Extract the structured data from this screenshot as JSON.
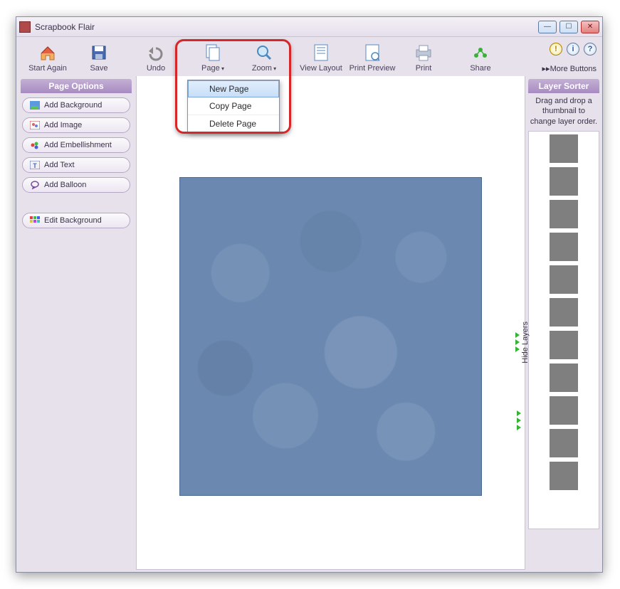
{
  "window": {
    "title": "Scrapbook Flair"
  },
  "toolbar": {
    "start_again": "Start Again",
    "save": "Save",
    "undo": "Undo",
    "page": "Page",
    "zoom": "Zoom",
    "view_layout": "View Layout",
    "print_preview": "Print Preview",
    "print": "Print",
    "share": "Share",
    "more_buttons": "More Buttons"
  },
  "page_menu": {
    "new_page": "New Page",
    "copy_page": "Copy Page",
    "delete_page": "Delete Page"
  },
  "sidebar_left": {
    "header": "Page Options",
    "add_background": "Add Background",
    "add_image": "Add Image",
    "add_embellishment": "Add Embellishment",
    "add_text": "Add Text",
    "add_balloon": "Add Balloon",
    "edit_background": "Edit Background"
  },
  "sidebar_right": {
    "header": "Layer Sorter",
    "hint": "Drag and drop a thumbnail to change layer order.",
    "hide_layers": "Hide Layers"
  },
  "help_icons": {
    "warning": "!",
    "info": "i",
    "help": "?"
  }
}
